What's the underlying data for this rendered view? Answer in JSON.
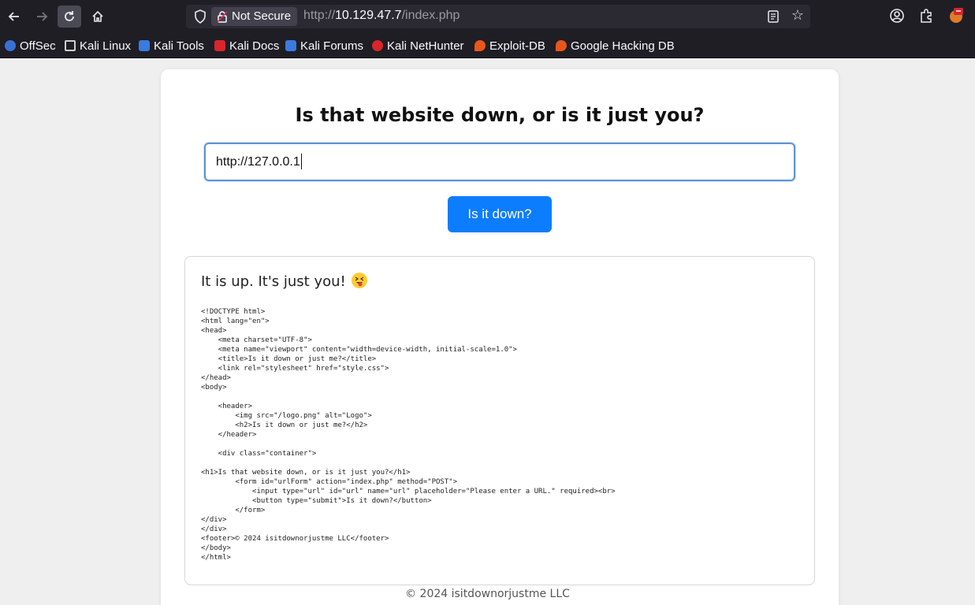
{
  "browser": {
    "security_label": "Not Secure",
    "url_prefix": "http://",
    "url_host": "10.129.47.7",
    "url_path": "/index.php",
    "bookmarks": [
      {
        "label": "OffSec",
        "icon": "offsec-icon",
        "color": "#3b6fd8"
      },
      {
        "label": "Kali Linux",
        "icon": "kali-dragon-icon",
        "color": "#cfcfcf"
      },
      {
        "label": "Kali Tools",
        "icon": "kali-tools-icon",
        "color": "#3a7be0"
      },
      {
        "label": "Kali Docs",
        "icon": "kali-docs-icon",
        "color": "#d8262b"
      },
      {
        "label": "Kali Forums",
        "icon": "kali-forums-icon",
        "color": "#3a7be0"
      },
      {
        "label": "Kali NetHunter",
        "icon": "nethunter-icon",
        "color": "#d8262b"
      },
      {
        "label": "Exploit-DB",
        "icon": "exploit-db-icon",
        "color": "#e8561c"
      },
      {
        "label": "Google Hacking DB",
        "icon": "ghdb-icon",
        "color": "#e8561c"
      }
    ]
  },
  "page": {
    "heading": "Is that website down, or is it just you?",
    "input_value": "http://127.0.0.1",
    "submit_label": "Is it down?",
    "result_title": "It is up. It's just you!",
    "result_emoji": "tongue-out-emoji",
    "result_source": "<!DOCTYPE html>\n<html lang=\"en\">\n<head>\n    <meta charset=\"UTF-8\">\n    <meta name=\"viewport\" content=\"width=device-width, initial-scale=1.0\">\n    <title>Is it down or just me?</title>\n    <link rel=\"stylesheet\" href=\"style.css\">\n</head>\n<body>\n\n    <header>\n        <img src=\"/logo.png\" alt=\"Logo\">\n        <h2>Is it down or just me?</h2>\n    </header>\n\n    <div class=\"container\">\n\n<h1>Is that website down, or is it just you?</h1>\n        <form id=\"urlForm\" action=\"index.php\" method=\"POST\">\n            <input type=\"url\" id=\"url\" name=\"url\" placeholder=\"Please enter a URL.\" required><br>\n            <button type=\"submit\">Is it down?</button>\n        </form>\n</div>\n</div>\n<footer>© 2024 isitdownorjustme LLC</footer>\n</body>\n</html>",
    "footer": "© 2024 isitdownorjustme LLC"
  }
}
